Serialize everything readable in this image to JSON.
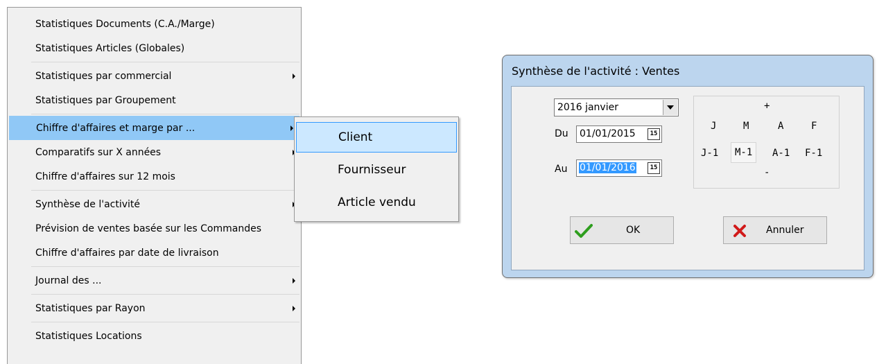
{
  "menu": {
    "items": [
      {
        "label": "Statistiques Documents  (C.A./Marge)"
      },
      {
        "label": "Statistiques Articles (Globales)"
      },
      {
        "label": "Statistiques par commercial",
        "submenu": true
      },
      {
        "label": "Statistiques par Groupement"
      },
      {
        "label": "Chiffre d'affaires et marge par ...",
        "submenu": true,
        "highlighted": true
      },
      {
        "label": "Comparatifs sur X années",
        "submenu": true
      },
      {
        "label": "Chiffre d'affaires sur 12 mois"
      },
      {
        "label": "Synthèse de l'activité",
        "submenu": true
      },
      {
        "label": "Prévision de ventes basée sur les Commandes"
      },
      {
        "label": "Chiffre d'affaires par date de livraison"
      },
      {
        "label": "Journal des ...",
        "submenu": true
      },
      {
        "label": "Statistiques par Rayon",
        "submenu": true
      },
      {
        "label": "Statistiques Locations"
      }
    ]
  },
  "submenu": {
    "items": [
      {
        "label": "Client",
        "highlighted": true
      },
      {
        "label": "Fournisseur"
      },
      {
        "label": "Article vendu"
      }
    ]
  },
  "dialog": {
    "title": "Synthèse de l'activité : Ventes",
    "month_select": "2016 janvier",
    "du_label": "Du",
    "du_value": "01/01/2015",
    "au_label": "Au",
    "au_value": "01/01/2016",
    "calendar_icon_text": "15",
    "period": {
      "plus": "+",
      "minus": "-",
      "top_row": [
        "J",
        "M",
        "A",
        "F"
      ],
      "bottom_row": [
        "J-1",
        "M-1",
        "A-1",
        "F-1"
      ]
    },
    "ok_label": "OK",
    "cancel_label": "Annuler"
  },
  "colors": {
    "menu_highlight": "#90c8f6",
    "submenu_highlight": "#cce8ff",
    "dialog_frame": "#bcd5ee",
    "ok_check": "#2e9e1e",
    "cancel_cross": "#d11a1a"
  }
}
